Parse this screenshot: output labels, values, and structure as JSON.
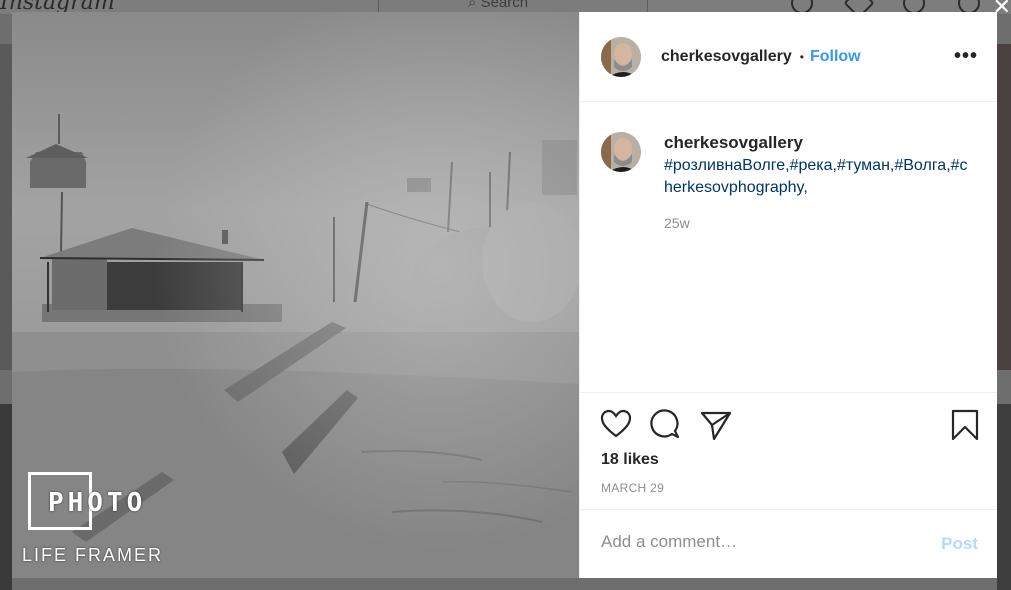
{
  "background": {
    "logo": "Instagram",
    "search_placeholder": "Search"
  },
  "post": {
    "username": "cherkesov­gallery",
    "follow_label": "Follow",
    "more_label": "•••",
    "caption_username": "cherkesovgallery",
    "caption_tags": "#розливнаВолге,#река,#туман,#Волга,#cherkesovphography,",
    "time_ago": "25w",
    "likes": "18 likes",
    "date": "MARCH 29",
    "comment_placeholder": "Add a comment…",
    "post_label": "Post"
  },
  "watermark": {
    "title": "PHOTO",
    "subtitle": "LIFE FRAMER"
  },
  "colors": {
    "accent": "#3897f0",
    "hashtag": "#003569",
    "muted": "#8e8e8e",
    "post_disabled": "#b3dbff"
  },
  "icons": [
    "heart-icon",
    "comment-icon",
    "share-icon",
    "bookmark-icon",
    "more-options-icon",
    "search-icon",
    "close-icon"
  ]
}
